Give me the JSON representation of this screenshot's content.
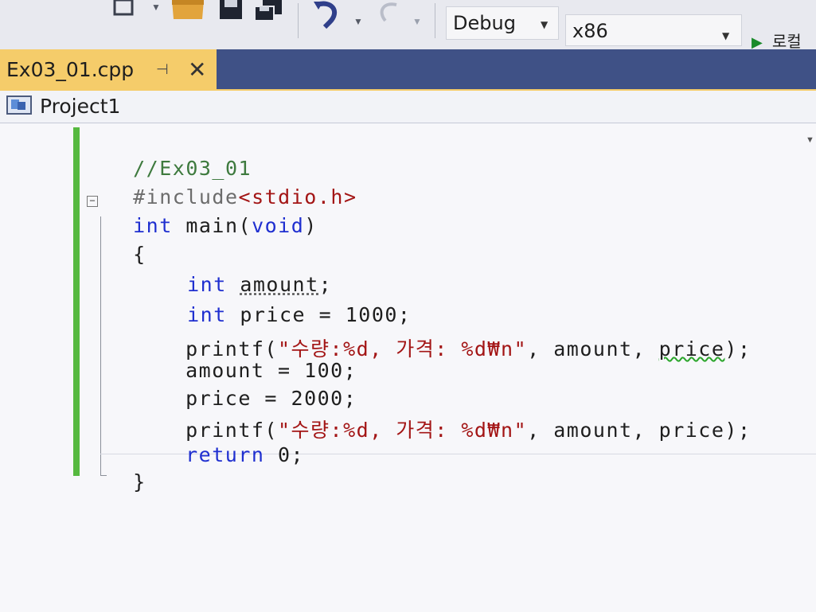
{
  "toolbar": {
    "config_value": "Debug",
    "platform_value": "x86",
    "run_label": "로컬"
  },
  "tab": {
    "filename": "Ex03_01.cpp",
    "pin_glyph": "⊣",
    "close_glyph": "✕"
  },
  "navbar": {
    "project": "Project1"
  },
  "code": {
    "l1_comment": "//Ex03_01",
    "l2_include": "#include",
    "l2_header": "<stdio.h>",
    "l3_int": "int",
    "l3_main": " main(",
    "l3_void": "void",
    "l3_close": ")",
    "l4_brace": "{",
    "l5_int": "int",
    "l5_rest_a": " ",
    "l5_amount": "amount",
    "l5_semi": ";",
    "l6_int": "int",
    "l6_rest": " price = 1000;",
    "l7_printf": "printf(",
    "l7_str": "\"수량:%d, 가격: %d₩n\"",
    "l7_args": ", amount, ",
    "l7_price": "price",
    "l7_end": ");",
    "l8": "amount = 100;",
    "l9": "price = 2000;",
    "l10_printf": "printf(",
    "l10_str": "\"수량:%d, 가격: %d₩n\"",
    "l10_args": ", amount, price);",
    "l11_return": "return",
    "l11_rest": " 0;",
    "l12_brace": "}"
  },
  "colors": {
    "tab_active": "#f5cc6a",
    "tabstrip": "#3f5186",
    "keyword": "#1f2fd0",
    "string": "#a31515",
    "change_marker": "#56b93f"
  }
}
